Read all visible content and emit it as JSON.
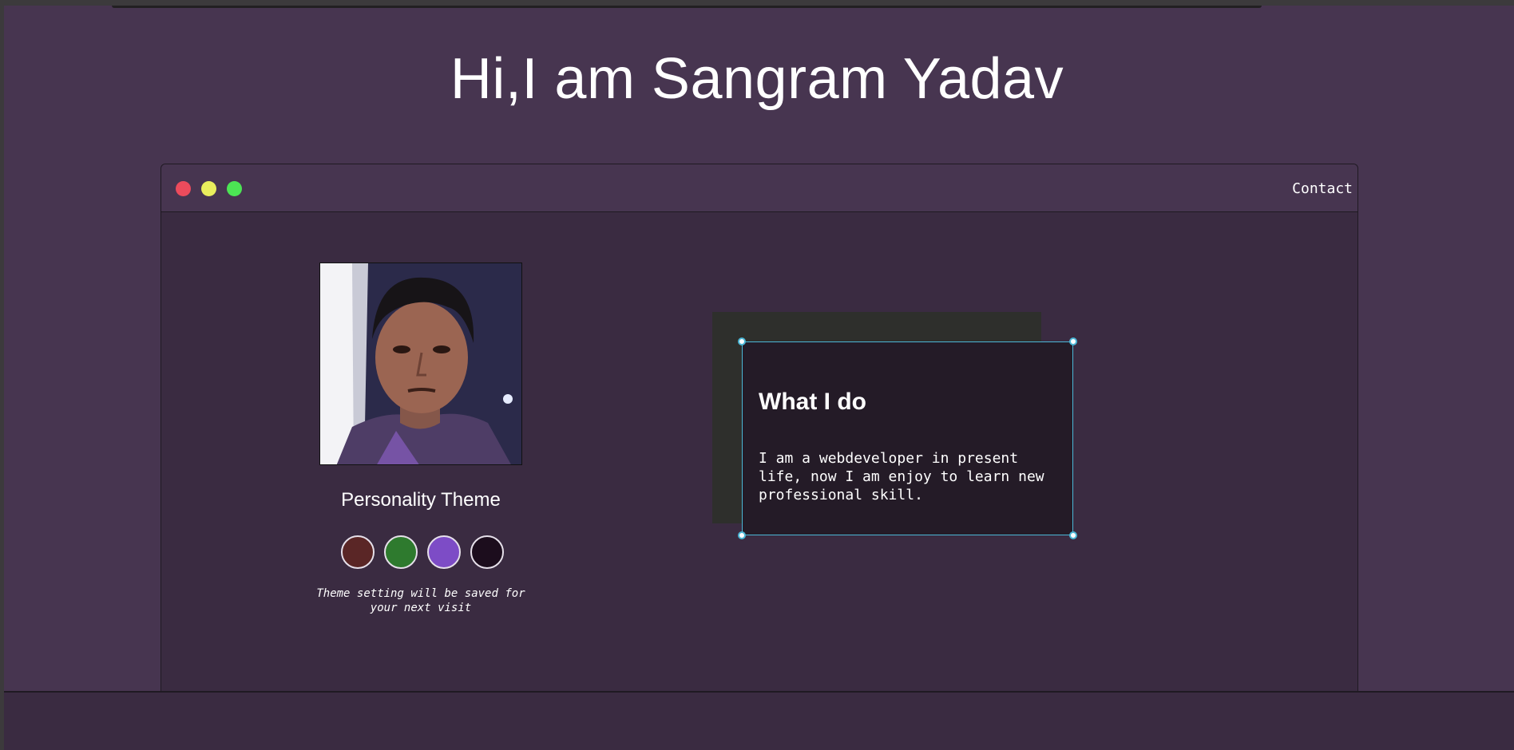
{
  "hero": {
    "title": "Hi,I am Sangram Yadav"
  },
  "window": {
    "controls": [
      "close",
      "minimize",
      "maximize"
    ],
    "nav": {
      "contact_label": "Contact"
    }
  },
  "profile": {
    "theme_title": "Personality Theme",
    "theme_note": "Theme setting will be saved for your next visit",
    "themes": [
      {
        "name": "maroon",
        "color": "#5a2626"
      },
      {
        "name": "green",
        "color": "#2e7a2e"
      },
      {
        "name": "purple",
        "color": "#7d4cc6"
      },
      {
        "name": "dark",
        "color": "#1c0d1d"
      }
    ]
  },
  "card": {
    "title": "What I do",
    "text": "I am a webdeveloper in present life, now I am enjoy to learn new professional skill."
  },
  "colors": {
    "page_bg": "#473550",
    "window_bg": "#3a2b41",
    "card_bg": "#241b27",
    "accent": "#4bb7d6"
  }
}
